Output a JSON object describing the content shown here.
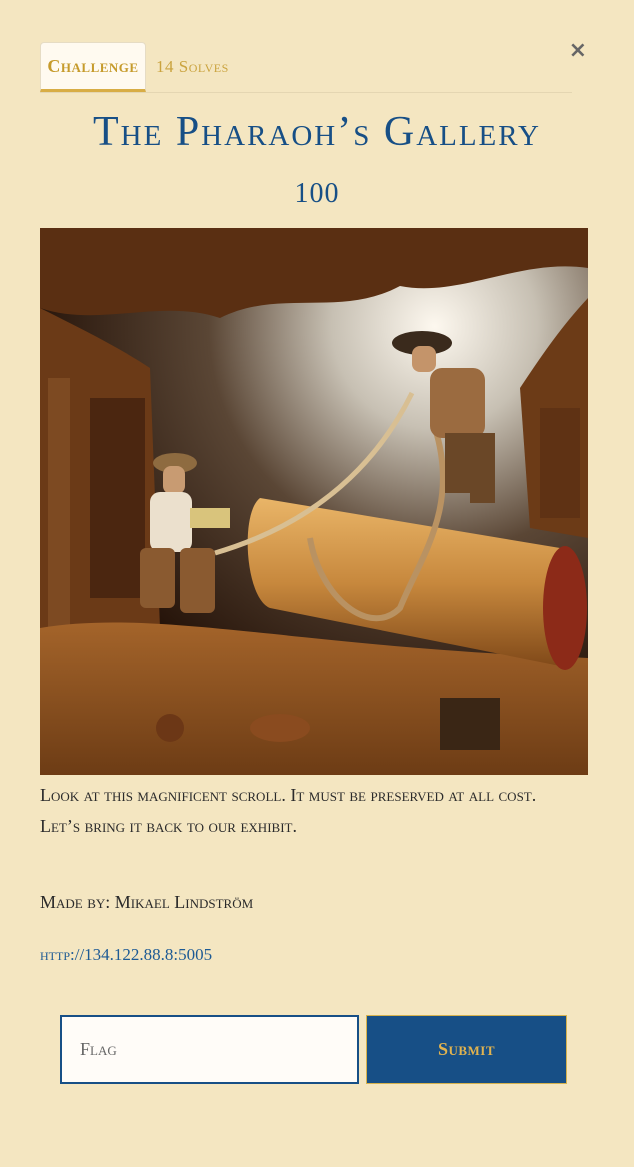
{
  "tabs": {
    "challenge": "Challenge",
    "solves": "14 Solves"
  },
  "close_label": "×",
  "challenge": {
    "title": "The Pharaoh’s Gallery",
    "points": "100",
    "description_line1": "Look at this magnificent scroll. It must be preserved at all cost.",
    "description_line2": "Let’s bring it back to our exhibit.",
    "author": "Made by: Mikael Lindström",
    "url": "http://134.122.88.8:5005"
  },
  "form": {
    "flag_placeholder": "Flag",
    "flag_value": "",
    "submit_label": "Submit"
  },
  "colors": {
    "background": "#f4e6c1",
    "primary": "#174f86",
    "accent": "#c9a33d"
  }
}
